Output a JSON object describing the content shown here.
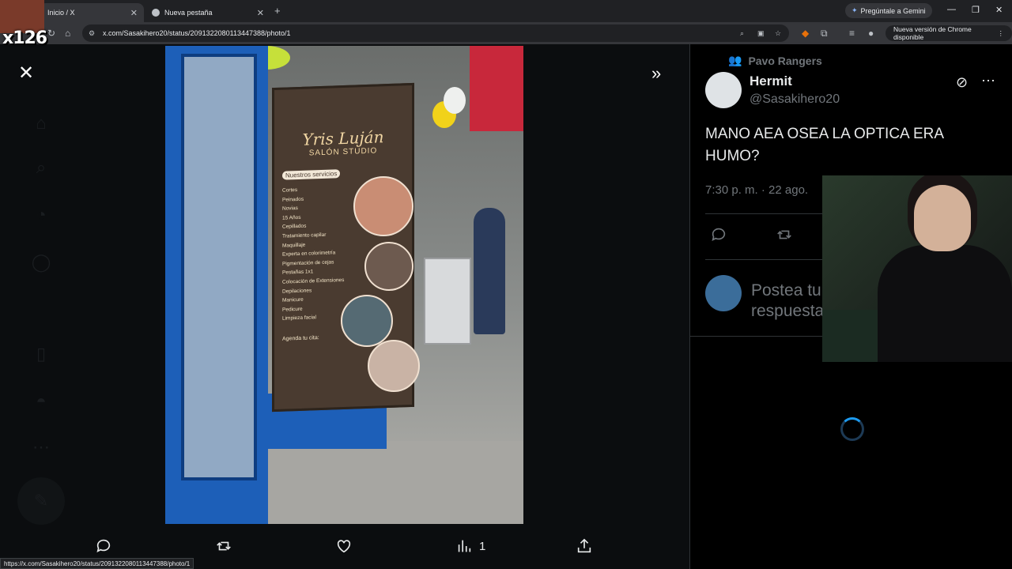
{
  "browser": {
    "tabs": [
      {
        "label": "Inicio / X",
        "active": true
      },
      {
        "label": "Nueva pestaña",
        "active": false
      }
    ],
    "gemini_label": "Pregúntale a Gemini",
    "url": "x.com/Sasakihero20/status/2091322080113447388/photo/1",
    "update_label": "Nueva versión de Chrome disponible",
    "status_url": "https://x.com/Sasakihero20/status/2091322080113447388/photo/1"
  },
  "overlay": {
    "multiplier": "x126"
  },
  "viewer": {
    "photo": {
      "sign_brand": "Yris Luján",
      "sign_sub": "SALÓN STUDIO",
      "sign_services_title": "Nuestros servicios",
      "sign_services": [
        "Cortes",
        "Peinados",
        "Novias",
        "15 Años",
        "Cepillados",
        "Tratamiento capilar",
        "Maquillaje",
        "Experta en colorimetría",
        "Pigmentación de cejas",
        "Pestañas 1x1",
        "Colocación de Extensiones",
        "Depilaciones",
        "Manicure",
        "Pedicure",
        "Limpieza facial"
      ],
      "sign_agenda": "Agenda tu cita:"
    },
    "actions": {
      "views_count": "1"
    }
  },
  "post": {
    "community": "Pavo Rangers",
    "author_name": "Hermit",
    "author_handle": "@Sasakihero20",
    "text": "MANO AEA OSEA LA OPTICA ERA HUMO?",
    "timestamp": "7:30 p. m. · 22 ago.",
    "reply_placeholder": "Postea tu respuesta"
  },
  "colors": {
    "accent": "#1d9bf0",
    "text_primary": "#e7e9ea",
    "text_secondary": "#71767b",
    "border": "#2f3336"
  }
}
